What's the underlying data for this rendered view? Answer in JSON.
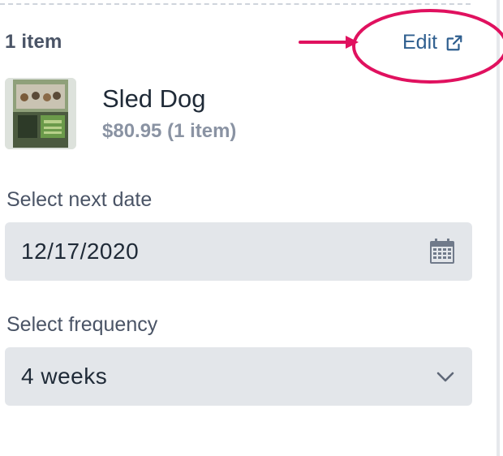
{
  "cart": {
    "item_count_label": "1 item",
    "edit_label": "Edit"
  },
  "product": {
    "name": "Sled Dog",
    "price_line": "$80.95 (1 item)",
    "image_icon": "product-thumbnail"
  },
  "next_date": {
    "label": "Select next date",
    "value": "12/17/2020",
    "icon": "calendar-icon"
  },
  "frequency": {
    "label": "Select frequency",
    "value": "4 weeks",
    "icon": "chevron-down-icon"
  },
  "colors": {
    "annotation": "#e0115f",
    "link": "#2f5f8f",
    "field_bg": "#e3e6ea",
    "muted_text": "#8a93a3"
  }
}
